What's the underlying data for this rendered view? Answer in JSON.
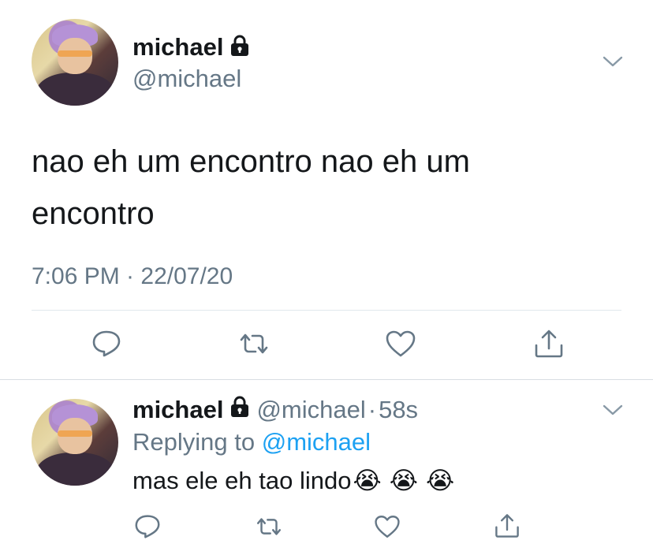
{
  "main_tweet": {
    "author_name": "michael",
    "author_handle": "@michael",
    "text_line1": "nao eh um encontro nao eh um",
    "text_line2": "encontro",
    "timestamp": "7:06 PM · 22/07/20"
  },
  "reply_tweet": {
    "author_name": "michael",
    "author_handle": "@michael",
    "separator": "·",
    "time_ago": "58s",
    "replying_prefix": "Replying to",
    "replying_handle": "@michael",
    "text": "mas ele eh tao lindo",
    "emojis": [
      "😭",
      "😭",
      "😭"
    ]
  },
  "icons": {
    "reply": "comment-bubble-icon",
    "retweet": "retweet-icon",
    "like": "heart-icon",
    "share": "share-upload-icon",
    "more": "chevron-down-icon",
    "protected": "lock-icon"
  },
  "colors": {
    "text": "#14171a",
    "muted": "#657786",
    "link": "#1da1f2",
    "divider": "#e1e8ed"
  }
}
